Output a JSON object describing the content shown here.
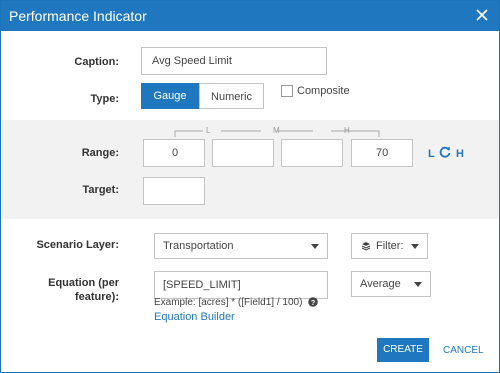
{
  "dialog": {
    "title": "Performance Indicator",
    "close_icon": "close-icon"
  },
  "caption": {
    "label": "Caption:",
    "value": "Avg Speed Limit"
  },
  "type": {
    "label": "Type:",
    "options": [
      "Gauge",
      "Numeric"
    ],
    "selected": "Gauge",
    "composite_label": "Composite",
    "composite_checked": false
  },
  "range": {
    "label": "Range:",
    "headers": [
      "L",
      "M",
      "H"
    ],
    "values": [
      "0",
      "",
      "",
      "70"
    ],
    "right_l": "L",
    "right_h": "H",
    "swap_icon": "refresh-icon"
  },
  "target": {
    "label": "Target:",
    "value": ""
  },
  "scenario_layer": {
    "label": "Scenario Layer:",
    "value": "Transportation",
    "filter_label": "Filter:",
    "filter_icon": "layers-icon"
  },
  "equation": {
    "label_line1": "Equation (per",
    "label_line2": "feature):",
    "value": "[SPEED_LIMIT]",
    "aggregate": "Average",
    "example": "Example: [acres] * ([Field1] / 100)",
    "help_icon": "help-icon",
    "builder_link": "Equation Builder"
  },
  "footer": {
    "create": "CREATE",
    "cancel": "CANCEL"
  },
  "colors": {
    "primary": "#1f78bf",
    "band": "#f2f2f2"
  }
}
